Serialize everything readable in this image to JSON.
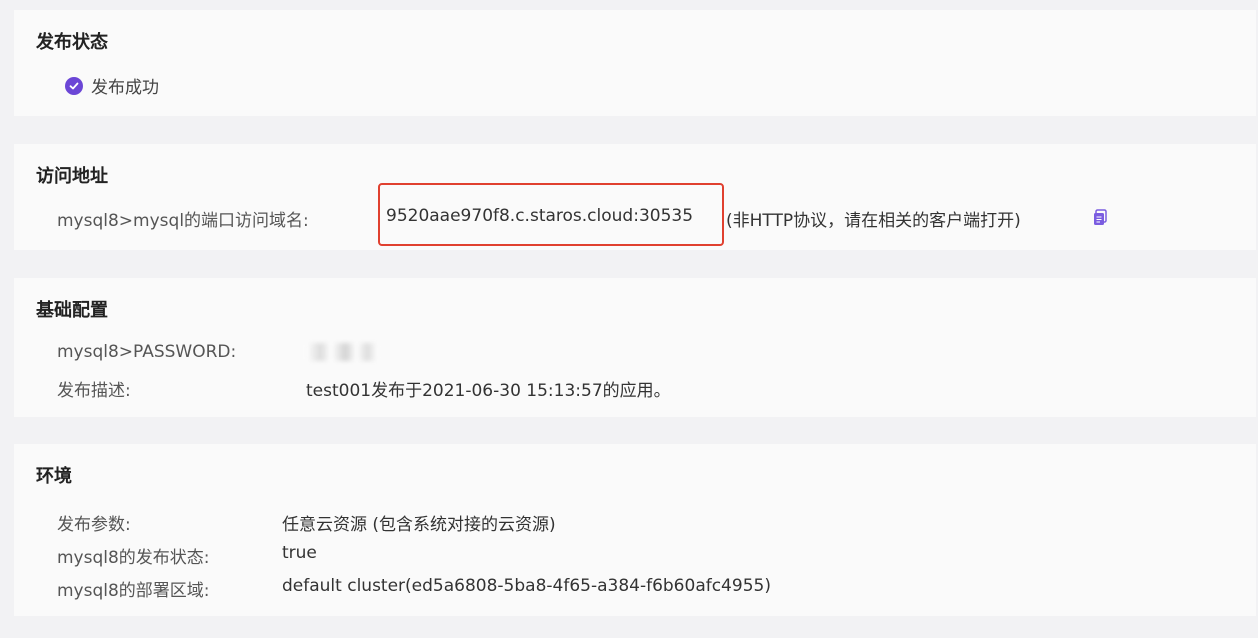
{
  "publish_status": {
    "title": "发布状态",
    "status_text": "发布成功"
  },
  "access": {
    "title": "访问地址",
    "label": "mysql8>mysql的端口访问域名:",
    "domain": "9520aae970f8.c.staros.cloud:30535",
    "note": "(非HTTP协议，请在相关的客户端打开)",
    "copy_icon": "copy-icon"
  },
  "basic": {
    "title": "基础配置",
    "password_label": "mysql8>PASSWORD:",
    "desc_label": "发布描述:",
    "desc_value": "test001发布于2021-06-30 15:13:57的应用。"
  },
  "env": {
    "title": "环境",
    "params_label": "发布参数:",
    "params_value": "任意云资源 (包含系统对接的云资源)",
    "state_label": "mysql8的发布状态:",
    "state_value": "true",
    "region_label": "mysql8的部署区域:",
    "region_value": "default cluster(ed5a6808-5ba8-4f65-a384-f6b60afc4955)"
  },
  "colors": {
    "accent": "#6b46d6",
    "highlight": "#e0402f"
  }
}
